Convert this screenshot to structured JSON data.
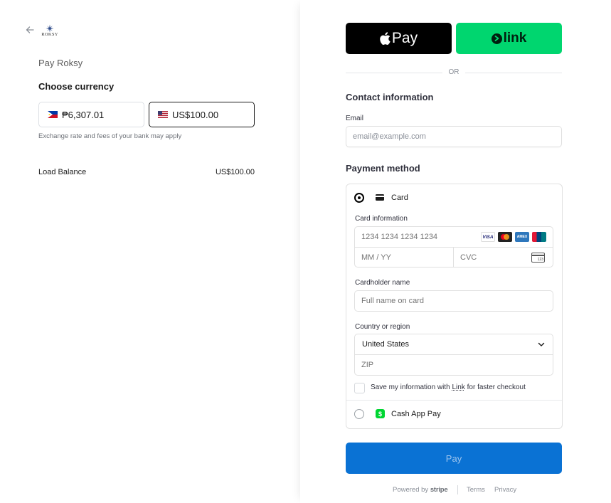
{
  "left": {
    "logo_text": "ROKSY",
    "pay_title": "Pay Roksy",
    "choose_currency": "Choose currency",
    "currencies": [
      {
        "amount": "₱6,307.01",
        "flag": "philippines-flag-icon",
        "selected": false
      },
      {
        "amount": "US$100.00",
        "flag": "us-flag-icon",
        "selected": true
      }
    ],
    "exchange_note": "Exchange rate and fees of your bank may apply",
    "line_item": {
      "label": "Load Balance",
      "value": "US$100.00"
    }
  },
  "express": {
    "apple_pay_label": "Pay",
    "link_label": "link",
    "or_text": "OR"
  },
  "contact": {
    "title": "Contact information",
    "email_label": "Email",
    "email_placeholder": "email@example.com"
  },
  "payment": {
    "title": "Payment method",
    "card_option_label": "Card",
    "card_info_label": "Card information",
    "card_number_placeholder": "1234 1234 1234 1234",
    "brands": [
      "VISA",
      "Mastercard",
      "AMEX",
      "UnionPay"
    ],
    "expiry_placeholder": "MM / YY",
    "cvc_placeholder": "CVC",
    "cvc_icon_text": "123",
    "cardholder_label": "Cardholder name",
    "cardholder_placeholder": "Full name on card",
    "country_label": "Country or region",
    "country_value": "United States",
    "zip_placeholder": "ZIP",
    "save_info_prefix": "Save my information with ",
    "save_info_link": "Link",
    "save_info_suffix": " for faster checkout",
    "cashapp_label": "Cash App Pay",
    "cashapp_icon": "$"
  },
  "pay_button": "Pay",
  "footer": {
    "powered_by": "Powered by ",
    "stripe": "stripe",
    "terms": "Terms",
    "privacy": "Privacy"
  },
  "colors": {
    "link_green": "#00d66f",
    "pay_blue": "#0a72d4",
    "cashapp_green": "#00d632"
  }
}
